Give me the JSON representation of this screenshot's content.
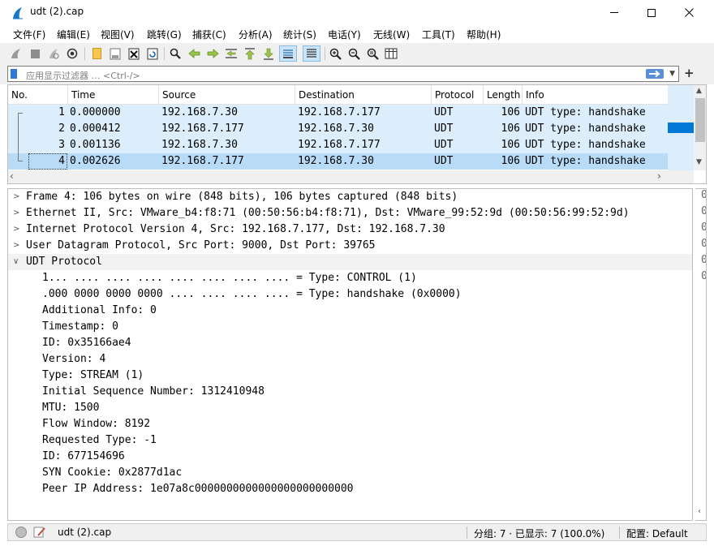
{
  "window": {
    "title": "udt (2).cap"
  },
  "menu": [
    "文件(F)",
    "编辑(E)",
    "视图(V)",
    "跳转(G)",
    "捕获(C)",
    "分析(A)",
    "统计(S)",
    "电话(Y)",
    "无线(W)",
    "工具(T)",
    "帮助(H)"
  ],
  "filter": {
    "placeholder": "应用显示过滤器 … <Ctrl-/>"
  },
  "packet_list": {
    "columns": [
      "No.",
      "Time",
      "Source",
      "Destination",
      "Protocol",
      "Length",
      "Info"
    ],
    "rows": [
      {
        "no": "1",
        "time": "0.000000",
        "source": "192.168.7.30",
        "destination": "192.168.7.177",
        "protocol": "UDT",
        "length": "106",
        "info": "UDT type: handshake"
      },
      {
        "no": "2",
        "time": "0.000412",
        "source": "192.168.7.177",
        "destination": "192.168.7.30",
        "protocol": "UDT",
        "length": "106",
        "info": "UDT type: handshake"
      },
      {
        "no": "3",
        "time": "0.001136",
        "source": "192.168.7.30",
        "destination": "192.168.7.177",
        "protocol": "UDT",
        "length": "106",
        "info": "UDT type: handshake"
      },
      {
        "no": "4",
        "time": "0.002626",
        "source": "192.168.7.177",
        "destination": "192.168.7.30",
        "protocol": "UDT",
        "length": "106",
        "info": "UDT type: handshake"
      }
    ],
    "selected_row": "4"
  },
  "details": [
    {
      "text": "Frame 4: 106 bytes on wire (848 bits), 106 bytes captured (848 bits)",
      "expander": "collapsed"
    },
    {
      "text": "Ethernet II, Src: VMware_b4:f8:71 (00:50:56:b4:f8:71), Dst: VMware_99:52:9d (00:50:56:99:52:9d)",
      "expander": "collapsed"
    },
    {
      "text": "Internet Protocol Version 4, Src: 192.168.7.177, Dst: 192.168.7.30",
      "expander": "collapsed"
    },
    {
      "text": "User Datagram Protocol, Src Port: 9000, Dst Port: 39765",
      "expander": "collapsed"
    },
    {
      "text": "UDT Protocol",
      "expander": "expanded"
    },
    {
      "text": "1... .... .... .... .... .... .... .... = Type: CONTROL (1)",
      "expander": "none"
    },
    {
      "text": ".000 0000 0000 0000 .... .... .... .... = Type: handshake (0x0000)",
      "expander": "none"
    },
    {
      "text": "Additional Info: 0",
      "expander": "none"
    },
    {
      "text": "Timestamp: 0",
      "expander": "none"
    },
    {
      "text": "ID: 0x35166ae4",
      "expander": "none"
    },
    {
      "text": "Version: 4",
      "expander": "none"
    },
    {
      "text": "Type: STREAM (1)",
      "expander": "none"
    },
    {
      "text": "Initial Sequence Number: 1312410948",
      "expander": "none"
    },
    {
      "text": "MTU: 1500",
      "expander": "none"
    },
    {
      "text": "Flow Window: 8192",
      "expander": "none"
    },
    {
      "text": "Requested Type: -1",
      "expander": "none"
    },
    {
      "text": "ID: 677154696",
      "expander": "none"
    },
    {
      "text": "SYN Cookie: 0x2877d1ac",
      "expander": "none"
    },
    {
      "text": "Peer IP Address: 1e07a8c0000000000000000000000000",
      "expander": "none"
    }
  ],
  "bytes_pane": [
    "0",
    "0",
    "0",
    "0",
    "0",
    "0"
  ],
  "status": {
    "file": "udt (2).cap",
    "packets": "分组: 7 · 已显示: 7 (100.0%)",
    "profile": "配置: Default"
  },
  "colors": {
    "row_bg": "#dcedfb",
    "selected_bg": "#b8dcf7",
    "accent": "#0078d7"
  },
  "icons": [
    "wireshark-fin-icon",
    "minimize-icon",
    "maximize-icon",
    "close-icon",
    "shark-fin-start-icon",
    "stop-icon",
    "restart-icon",
    "options-gear-icon",
    "open-file-icon",
    "save-file-icon",
    "close-file-icon",
    "reload-icon",
    "find-packet-icon",
    "back-arrow-icon",
    "forward-arrow-icon",
    "go-to-packet-icon",
    "first-packet-icon",
    "last-packet-icon",
    "autoscroll-icon",
    "colorize-icon",
    "zoom-in-icon",
    "zoom-out-icon",
    "zoom-normal-icon",
    "resize-columns-icon",
    "bookmark-icon",
    "apply-filter-icon",
    "add-filter-icon",
    "expert-info-icon",
    "comment-edit-icon"
  ]
}
